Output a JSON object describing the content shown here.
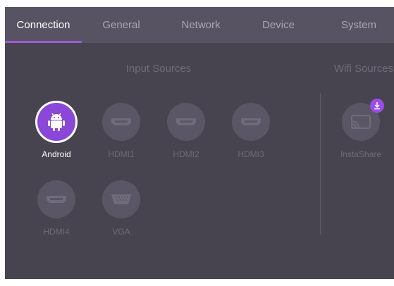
{
  "tabs": [
    {
      "label": "Connection",
      "active": true
    },
    {
      "label": "General",
      "active": false
    },
    {
      "label": "Network",
      "active": false
    },
    {
      "label": "Device",
      "active": false
    },
    {
      "label": "System",
      "active": false
    }
  ],
  "sections": {
    "input_title": "Input Sources",
    "wifi_title": "Wifi Sources"
  },
  "input_sources": [
    {
      "label": "Android",
      "icon": "android-icon",
      "selected": true
    },
    {
      "label": "HDMI1",
      "icon": "hdmi-icon",
      "selected": false
    },
    {
      "label": "HDMI2",
      "icon": "hdmi-icon",
      "selected": false
    },
    {
      "label": "HDMI3",
      "icon": "hdmi-icon",
      "selected": false
    },
    {
      "label": "HDMI4",
      "icon": "hdmi-icon",
      "selected": false
    },
    {
      "label": "VGA",
      "icon": "vga-icon",
      "selected": false
    }
  ],
  "wifi_sources": [
    {
      "label": "InstaShare",
      "icon": "cast-icon",
      "badge_icon": "download-icon"
    }
  ],
  "colors": {
    "accent": "#8a47d8",
    "background": "#47444f",
    "topbar": "#575363"
  }
}
